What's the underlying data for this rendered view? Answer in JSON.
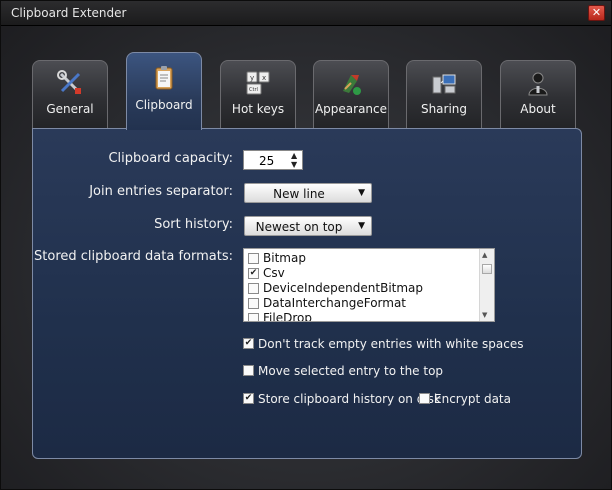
{
  "window": {
    "title": "Clipboard Extender"
  },
  "tabs": [
    {
      "label": "General",
      "icon": "tools-icon"
    },
    {
      "label": "Clipboard",
      "icon": "clipboard-icon"
    },
    {
      "label": "Hot keys",
      "icon": "keyboard-icon"
    },
    {
      "label": "Appearance",
      "icon": "paint-icon"
    },
    {
      "label": "Sharing",
      "icon": "network-icon"
    },
    {
      "label": "About",
      "icon": "person-icon"
    }
  ],
  "active_tab": "Clipboard",
  "clipboard": {
    "capacity_label": "Clipboard capacity:",
    "capacity_value": "25",
    "separator_label": "Join entries separator:",
    "separator_value": "New line",
    "sort_label": "Sort history:",
    "sort_value": "Newest on top",
    "formats_label": "Stored clipboard data formats:",
    "formats": [
      {
        "label": "Bitmap",
        "checked": false
      },
      {
        "label": "Csv",
        "checked": true
      },
      {
        "label": "DeviceIndependentBitmap",
        "checked": false
      },
      {
        "label": "DataInterchangeFormat",
        "checked": false
      },
      {
        "label": "FileDrop",
        "checked": false
      }
    ],
    "options": {
      "dont_track_empty": {
        "label": "Don't track empty entries with white spaces",
        "checked": true
      },
      "move_selected_top": {
        "label": "Move selected entry to the top",
        "checked": false
      },
      "store_history": {
        "label": "Store clipboard history on disk",
        "checked": true
      },
      "encrypt": {
        "label": "Encrypt data",
        "checked": false
      }
    }
  }
}
